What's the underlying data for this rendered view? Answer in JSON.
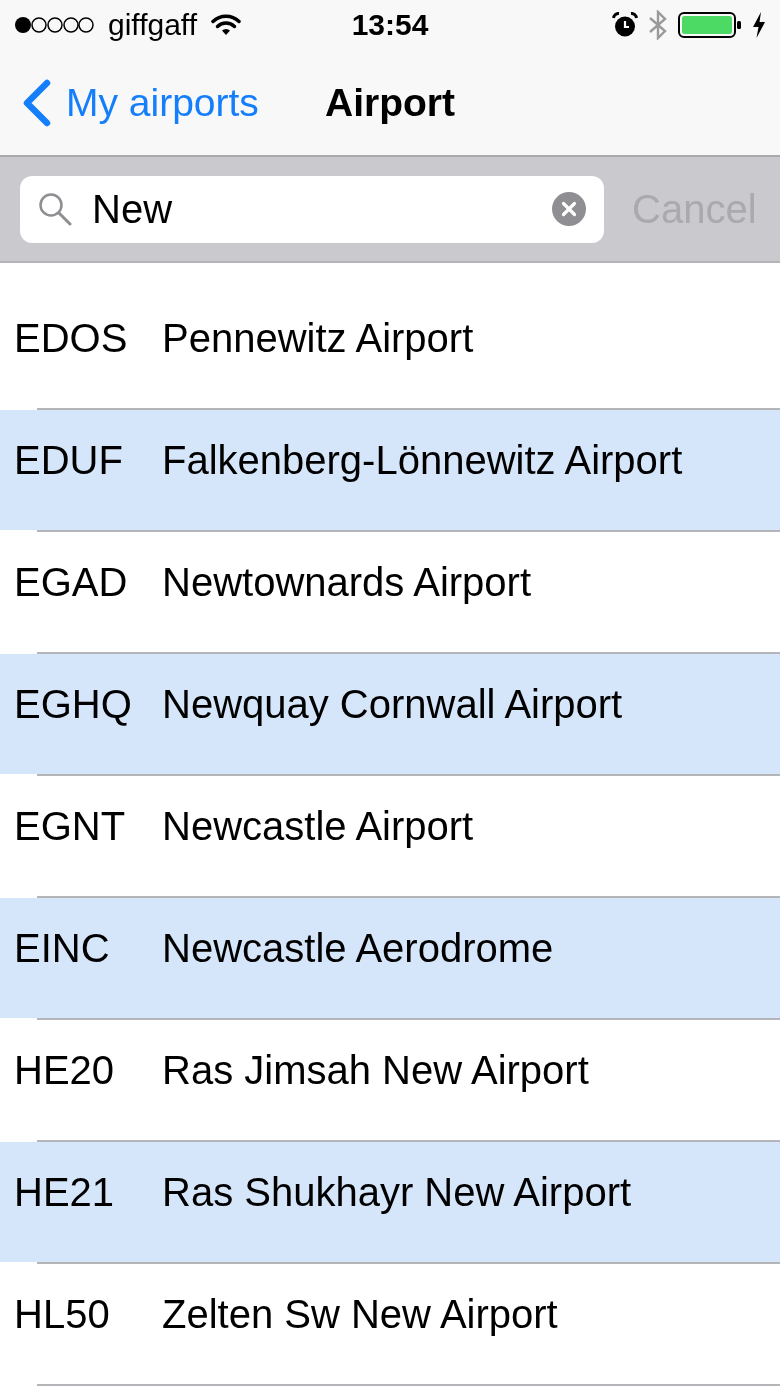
{
  "status_bar": {
    "carrier": "giffgaff",
    "time": "13:54"
  },
  "nav_bar": {
    "back_label": "My airports",
    "title": "Airport"
  },
  "search": {
    "value": "New",
    "cancel": {
      "label": "Cancel",
      "disabled": true
    }
  },
  "airports": [
    {
      "code": "EDOS",
      "name": "Pennewitz Airport"
    },
    {
      "code": "EDUF",
      "name": "Falkenberg-Lönnewitz Airport"
    },
    {
      "code": "EGAD",
      "name": "Newtownards Airport"
    },
    {
      "code": "EGHQ",
      "name": "Newquay Cornwall Airport"
    },
    {
      "code": "EGNT",
      "name": "Newcastle Airport"
    },
    {
      "code": "EINC",
      "name": "Newcastle Aerodrome"
    },
    {
      "code": "HE20",
      "name": "Ras Jimsah New Airport"
    },
    {
      "code": "HE21",
      "name": "Ras Shukhayr New Airport"
    },
    {
      "code": "HL50",
      "name": "Zelten Sw New Airport"
    }
  ]
}
